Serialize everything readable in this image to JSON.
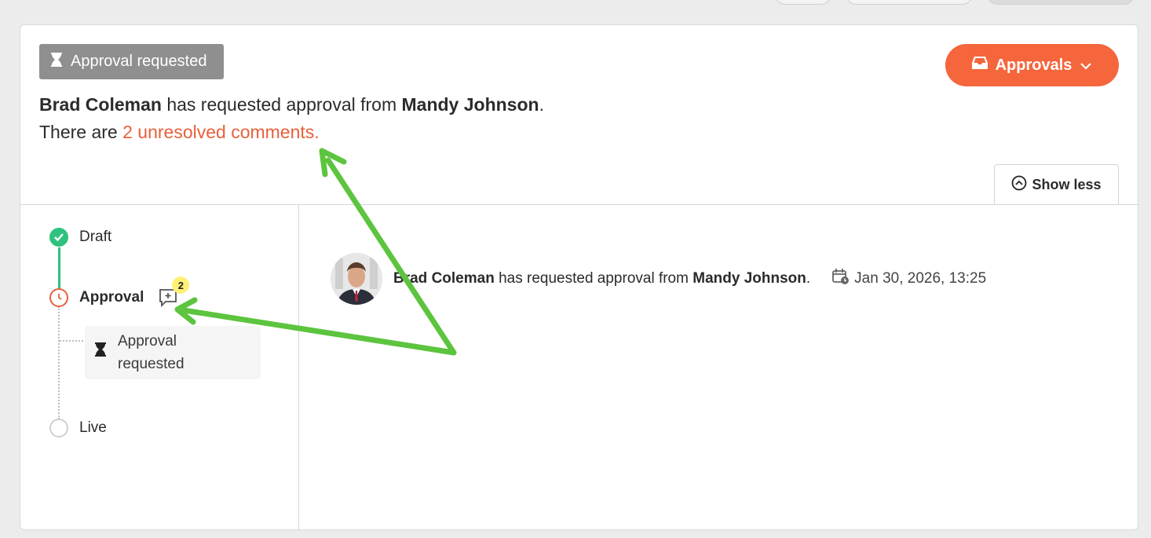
{
  "status_pill": {
    "label": "Approval requested",
    "icon": "hourglass-icon"
  },
  "header": {
    "requester": "Brad Coleman",
    "middle_text": "has requested approval from",
    "approver": "Mandy Johnson",
    "end_text": ".",
    "comments_prefix": "There are",
    "comments_link": "2 unresolved comments."
  },
  "approvals_button": {
    "label": "Approvals",
    "icon": "inbox-icon"
  },
  "show_less": {
    "label": "Show less",
    "icon": "chevron-up-circle-icon"
  },
  "steps": [
    {
      "label": "Draft",
      "state": "done"
    },
    {
      "label": "Approval",
      "state": "current",
      "comment_count": "2"
    },
    {
      "label": "Live",
      "state": "pending"
    }
  ],
  "substep": {
    "line1": "Approval",
    "line2": "requested",
    "icon": "hourglass-icon"
  },
  "activity": {
    "name": "Brad Coleman",
    "text": "has requested approval from",
    "target": "Mandy Johnson",
    "end": ".",
    "date": "Jan 30, 2026, 13:25"
  },
  "colors": {
    "accent": "#f5663c",
    "link": "#e8603c",
    "success": "#2ec27e",
    "annotation": "#5cc43e"
  }
}
